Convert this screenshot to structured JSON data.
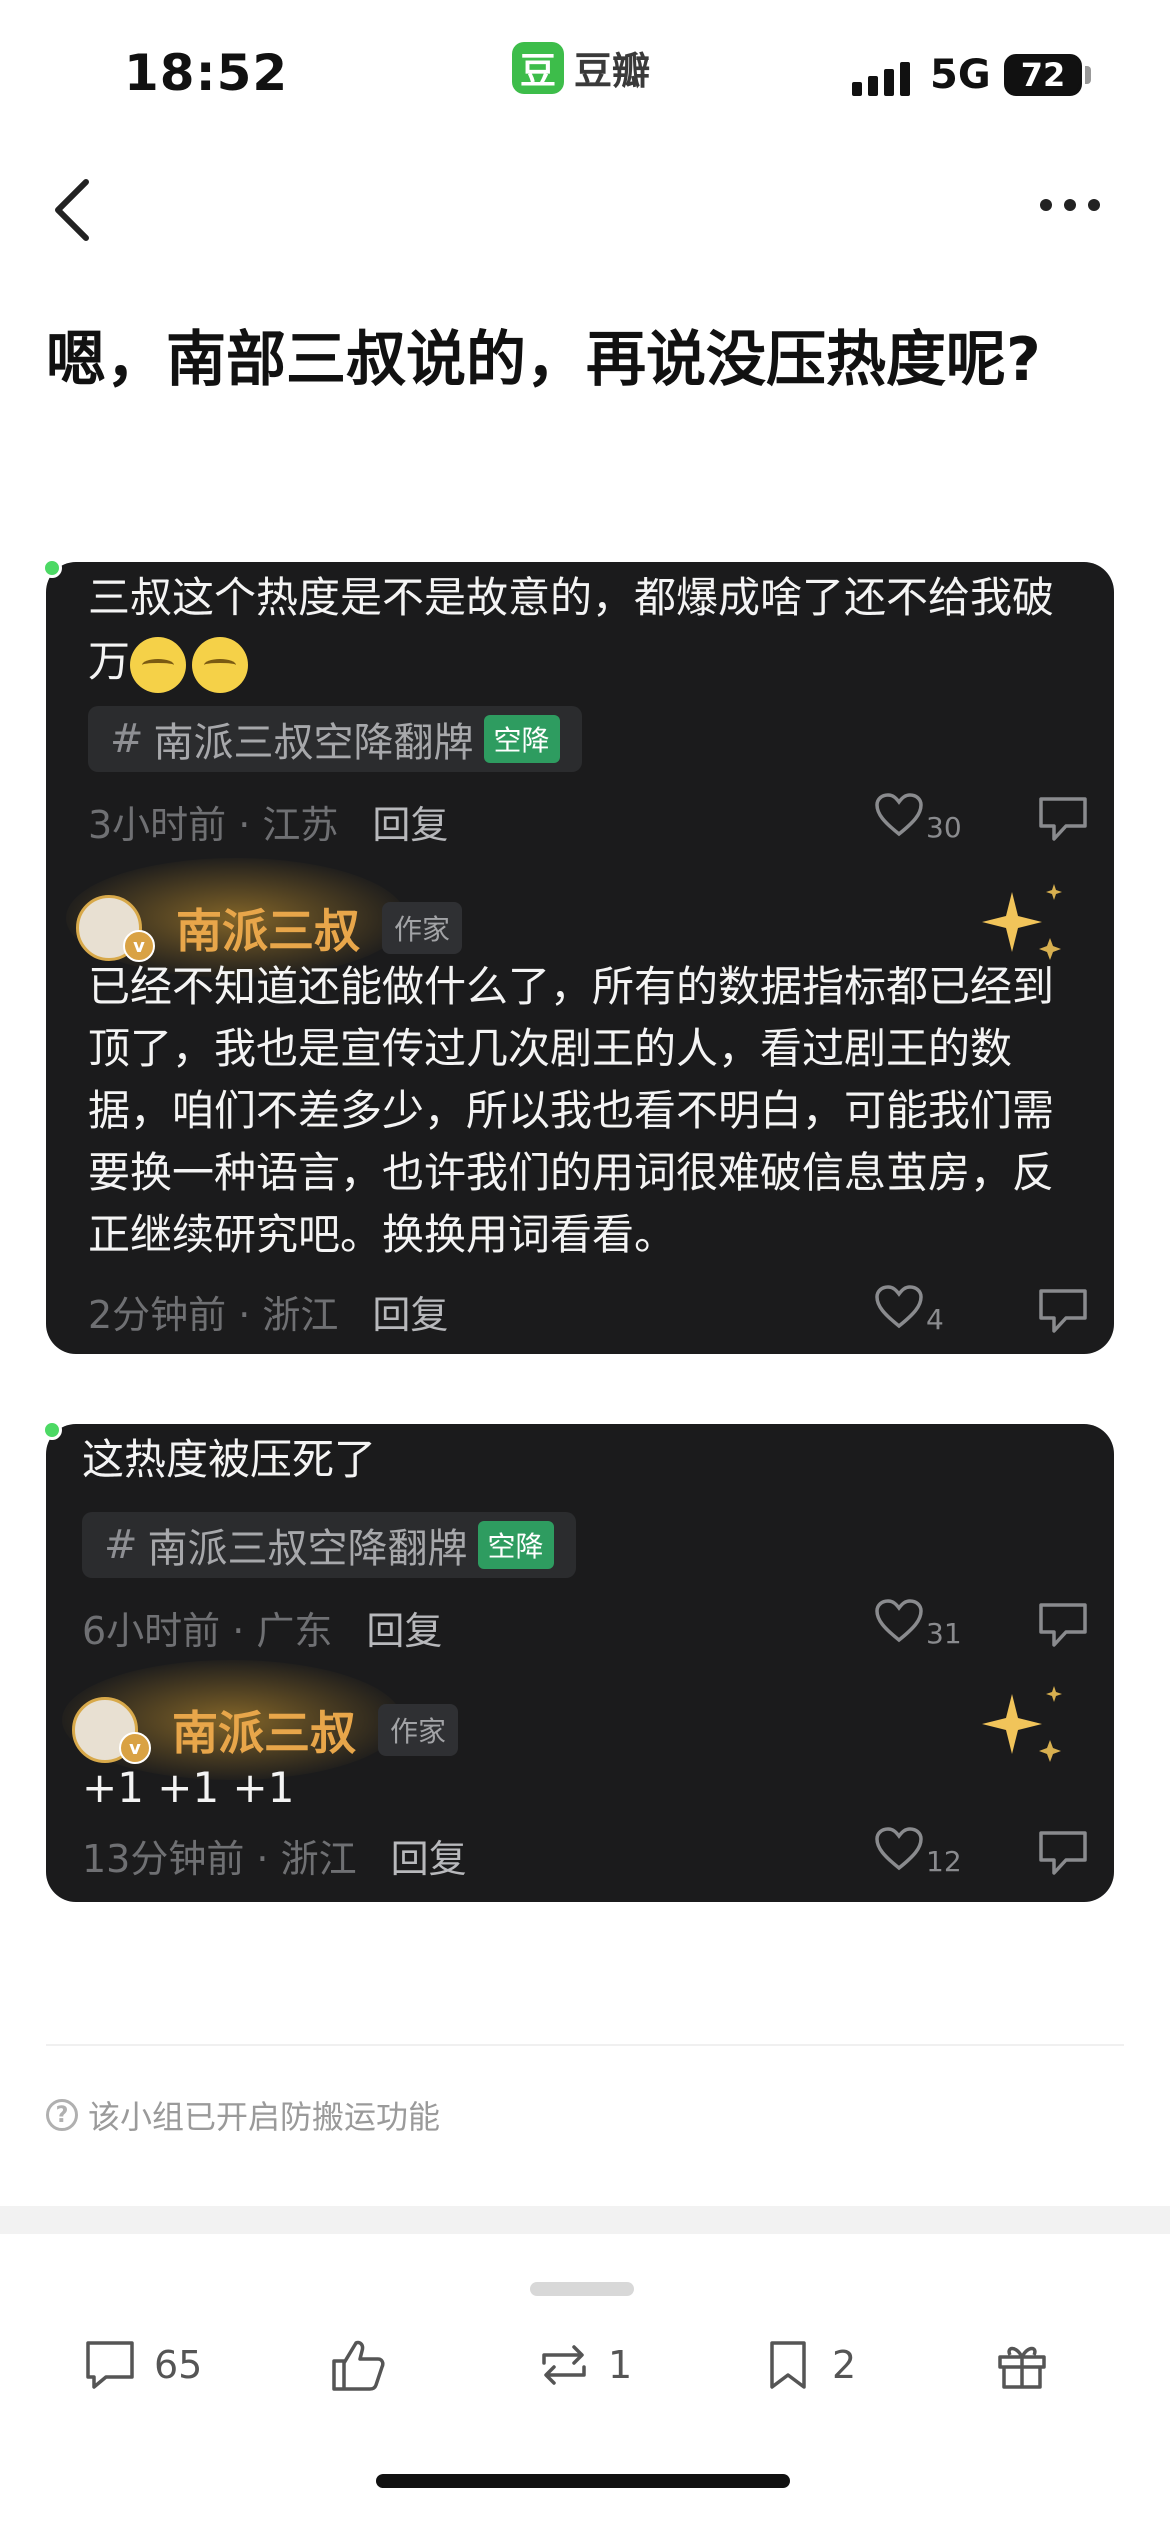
{
  "status_bar": {
    "time": "18:52",
    "app_logo_char": "豆",
    "app_name": "豆瓣",
    "network": "5G",
    "battery": "72"
  },
  "nav": {
    "back_icon": "chevron-left-icon",
    "more_icon": "more-dots-icon"
  },
  "post": {
    "title": "嗯，南部三叔说的，再说没压热度呢?"
  },
  "comments": [
    {
      "text": "三叔这个热度是不是故意的，都爆成啥了还不给我破万",
      "emoji_count": 2,
      "tag": {
        "hash": "#",
        "label": "南派三叔空降翻牌",
        "badge": "空降"
      },
      "time_location": "3小时前 · 江苏",
      "reply_label": "回复",
      "likes": "30",
      "reply": {
        "author": "南派三叔",
        "role": "作家",
        "verified_badge": "v",
        "text": "已经不知道还能做什么了，所有的数据指标都已经到顶了，我也是宣传过几次剧王的人，看过剧王的数据，咱们不差多少，所以我也看不明白，可能我们需要换一种语言，也许我们的用词很难破信息茧房，反正继续研究吧。换换用词看看。",
        "time_location": "2分钟前 · 浙江",
        "reply_label": "回复",
        "likes": "4"
      }
    },
    {
      "text": "这热度被压死了",
      "tag": {
        "hash": "#",
        "label": "南派三叔空降翻牌",
        "badge": "空降"
      },
      "time_location": "6小时前 · 广东",
      "reply_label": "回复",
      "likes": "31",
      "reply": {
        "author": "南派三叔",
        "role": "作家",
        "verified_badge": "v",
        "text": "+1 +1 +1",
        "time_location": "13分钟前 · 浙江",
        "reply_label": "回复",
        "likes": "12"
      }
    }
  ],
  "notice": {
    "icon": "?",
    "text": "该小组已开启防搬运功能"
  },
  "toolbar": {
    "comments": "65",
    "likes": "",
    "reposts": "1",
    "collects": "2"
  },
  "colors": {
    "card_bg": "#1b1b1c",
    "author_gold": "#e8a64a",
    "tag_badge_green": "#2e9c60",
    "douban_green": "#3dbd4a"
  }
}
